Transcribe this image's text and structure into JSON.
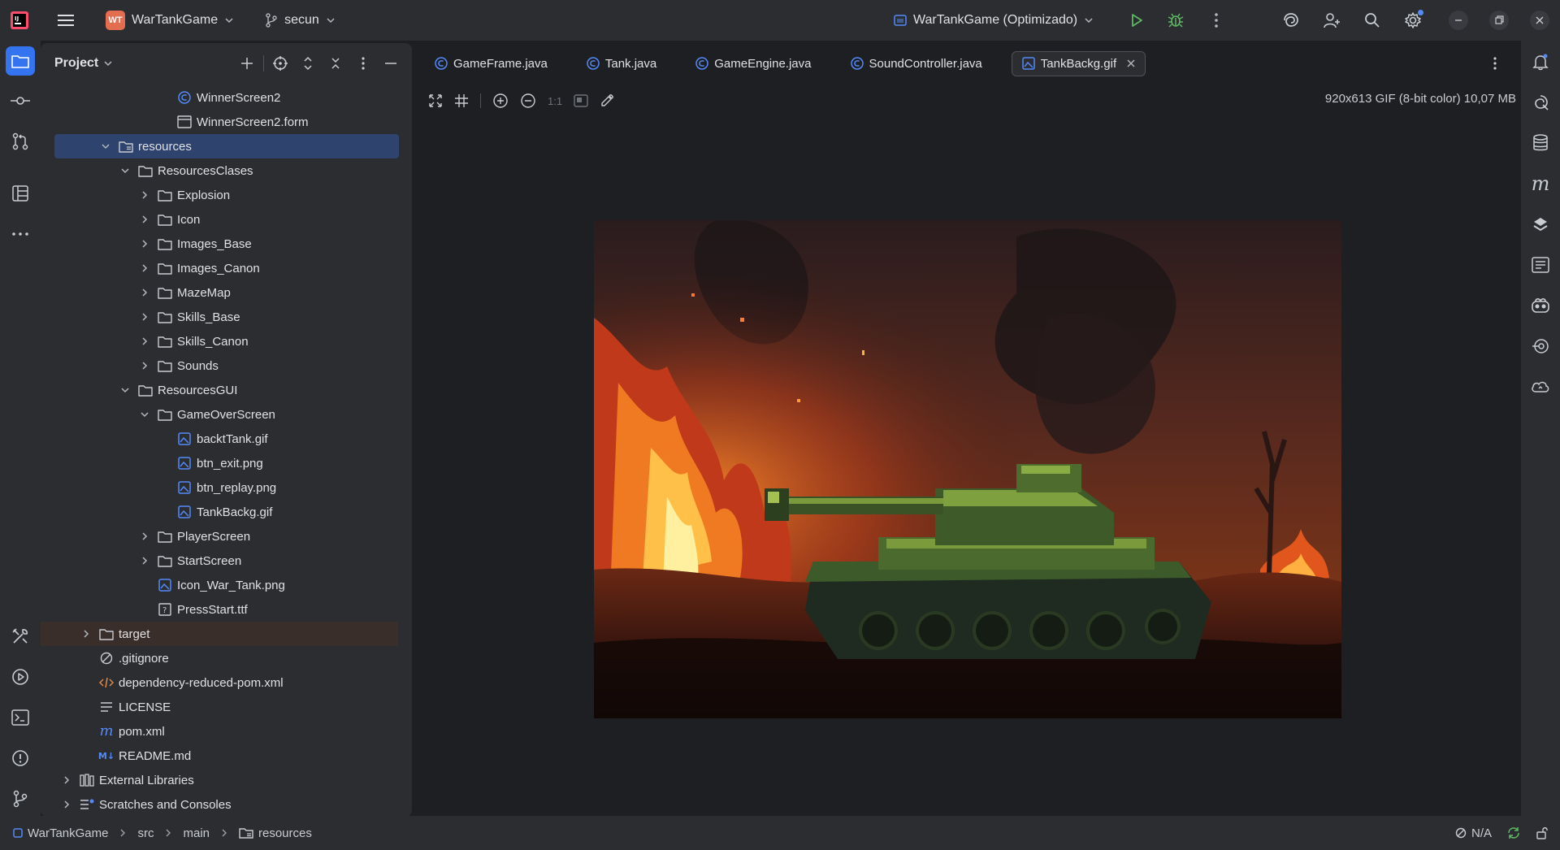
{
  "titlebar": {
    "project_initials": "WT",
    "project_name": "WarTankGame",
    "branch": "secun",
    "run_config": "WarTankGame (Optimizado)"
  },
  "project_panel": {
    "title": "Project",
    "tree": [
      {
        "label": "WinnerScreen2",
        "icon": "java-class-icon"
      },
      {
        "label": "WinnerScreen2.form",
        "icon": "form-icon"
      },
      {
        "label": "resources",
        "icon": "resources-folder-icon"
      },
      {
        "label": "ResourcesClases",
        "icon": "folder-icon"
      },
      {
        "label": "Explosion",
        "icon": "folder-icon"
      },
      {
        "label": "Icon",
        "icon": "folder-icon"
      },
      {
        "label": "Images_Base",
        "icon": "folder-icon"
      },
      {
        "label": "Images_Canon",
        "icon": "folder-icon"
      },
      {
        "label": "MazeMap",
        "icon": "folder-icon"
      },
      {
        "label": "Skills_Base",
        "icon": "folder-icon"
      },
      {
        "label": "Skills_Canon",
        "icon": "folder-icon"
      },
      {
        "label": "Sounds",
        "icon": "folder-icon"
      },
      {
        "label": "ResourcesGUI",
        "icon": "folder-icon"
      },
      {
        "label": "GameOverScreen",
        "icon": "folder-icon"
      },
      {
        "label": "backtTank.gif",
        "icon": "image-icon"
      },
      {
        "label": "btn_exit.png",
        "icon": "image-icon"
      },
      {
        "label": "btn_replay.png",
        "icon": "image-icon"
      },
      {
        "label": "TankBackg.gif",
        "icon": "image-icon"
      },
      {
        "label": "PlayerScreen",
        "icon": "folder-icon"
      },
      {
        "label": "StartScreen",
        "icon": "folder-icon"
      },
      {
        "label": "Icon_War_Tank.png",
        "icon": "image-icon"
      },
      {
        "label": "PressStart.ttf",
        "icon": "font-file-icon"
      },
      {
        "label": "target",
        "icon": "folder-icon"
      },
      {
        "label": ".gitignore",
        "icon": "gitignore-icon"
      },
      {
        "label": "dependency-reduced-pom.xml",
        "icon": "xml-icon"
      },
      {
        "label": "LICENSE",
        "icon": "text-file-icon"
      },
      {
        "label": "pom.xml",
        "icon": "maven-icon"
      },
      {
        "label": "README.md",
        "icon": "markdown-icon"
      },
      {
        "label": "External Libraries",
        "icon": "library-icon"
      },
      {
        "label": "Scratches and Consoles",
        "icon": "scratches-icon"
      }
    ]
  },
  "editor": {
    "tabs": [
      {
        "label": "GameFrame.java"
      },
      {
        "label": "Tank.java"
      },
      {
        "label": "GameEngine.java"
      },
      {
        "label": "SoundController.java"
      },
      {
        "label": "TankBackg.gif"
      }
    ],
    "zoom_label": "1:1",
    "image_info": "920x613 GIF (8-bit color) 10,07 MB"
  },
  "statusbar": {
    "crumbs": [
      "WarTankGame",
      "src",
      "main",
      "resources"
    ],
    "na_label": "N/A"
  },
  "colors": {
    "accent": "#3574f0",
    "selection": "#2e436e",
    "panel": "#2b2d30",
    "editor_bg": "#1e1f22"
  }
}
